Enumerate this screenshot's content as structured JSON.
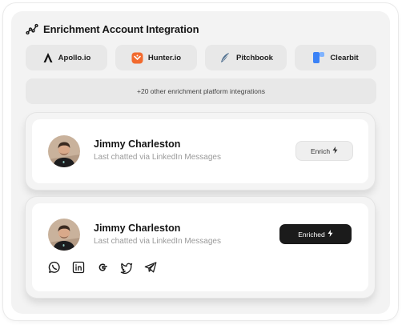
{
  "header": {
    "title": "Enrichment Account Integration",
    "icon": "analytics-icon"
  },
  "integrations": [
    {
      "label": "Apollo.io",
      "icon": "apollo-icon"
    },
    {
      "label": "Hunter.io",
      "icon": "hunter-icon",
      "color": "#f26a2e"
    },
    {
      "label": "Pitchbook",
      "icon": "pitchbook-icon",
      "color": "#4f6f8f"
    },
    {
      "label": "Clearbit",
      "icon": "clearbit-icon",
      "color": "#3b82f6"
    }
  ],
  "more_integrations": "+20 other enrichment platform integrations",
  "contacts": [
    {
      "name": "Jimmy Charleston",
      "subtitle": "Last chatted via LinkedIn Messages",
      "action_label": "Enrich",
      "state": "not-enriched"
    },
    {
      "name": "Jimmy Charleston",
      "subtitle": "Last chatted via LinkedIn Messages",
      "action_label": "Enriched",
      "state": "enriched",
      "socials": [
        "whatsapp-icon",
        "linkedin-icon",
        "google-icon",
        "twitter-icon",
        "telegram-icon"
      ]
    }
  ],
  "colors": {
    "enriched_button": "#1b1b1b",
    "panel": "#f3f3f3"
  }
}
